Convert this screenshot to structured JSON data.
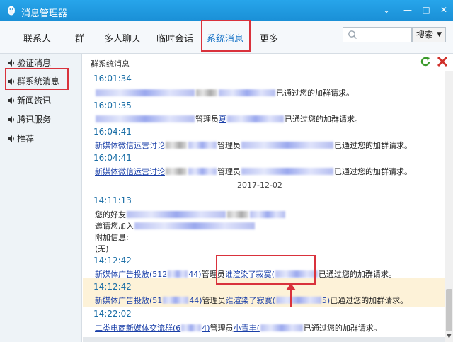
{
  "window": {
    "title": "消息管理器"
  },
  "tabs": [
    {
      "label": "联系人"
    },
    {
      "label": "群"
    },
    {
      "label": "多人聊天"
    },
    {
      "label": "临时会话"
    },
    {
      "label": "系统消息",
      "active": true
    },
    {
      "label": "更多"
    }
  ],
  "search": {
    "placeholder": "",
    "button_label": "搜索"
  },
  "sidebar": {
    "items": [
      {
        "label": "验证消息"
      },
      {
        "label": "群系统消息",
        "selected": true
      },
      {
        "label": "新闻资讯"
      },
      {
        "label": "腾讯服务"
      },
      {
        "label": "推荐"
      }
    ]
  },
  "content": {
    "header": "群系统消息",
    "date_separator": "2017-12-02",
    "messages": [
      {
        "time": "16:01:34",
        "manager": "",
        "text": "已通过您的加群请求。"
      },
      {
        "time": "16:01:35",
        "manager": "管理员",
        "manager_name": "夏",
        "text": "已通过您的加群请求。"
      },
      {
        "time": "16:04:41",
        "group": "新媒体微信运营讨论",
        "manager": "管理员",
        "text": "已通过您的加群请求。"
      },
      {
        "time": "16:04:41",
        "group": "新媒体微信运营讨论",
        "manager": "管理员",
        "text": "已通过您的加群请求。"
      },
      {
        "time": "14:11:13",
        "lines": [
          "您的好友",
          "邀请您加入",
          "附加信息:",
          "(无)"
        ]
      },
      {
        "time": "14:12:42",
        "group": "新媒体广告投放(512",
        "group_tail": "44)",
        "manager": "管理员",
        "manager_name": "谁渲染了寂寞(",
        "text": "已通过您的加群请求。"
      },
      {
        "time": "14:12:42",
        "group": "新媒体广告投放(51",
        "group_tail": "44)",
        "manager": "管理员",
        "manager_name": "谁渲染了寂寞(",
        "manager_tail": "5)",
        "text": "已通过您的加群请求。"
      },
      {
        "time": "14:22:02",
        "group": "二类电商新媒体交流群(6",
        "group_tail": "4)",
        "manager": "管理员",
        "manager_name": "小青丰(",
        "text": "已通过您的加群请求。"
      }
    ]
  },
  "colors": {
    "titlebar": "#1a8fd6",
    "highlight_box": "#d9323c",
    "link": "#1a3fa8",
    "time": "#1a6ea6",
    "row_highlight": "#fdf2d8"
  }
}
